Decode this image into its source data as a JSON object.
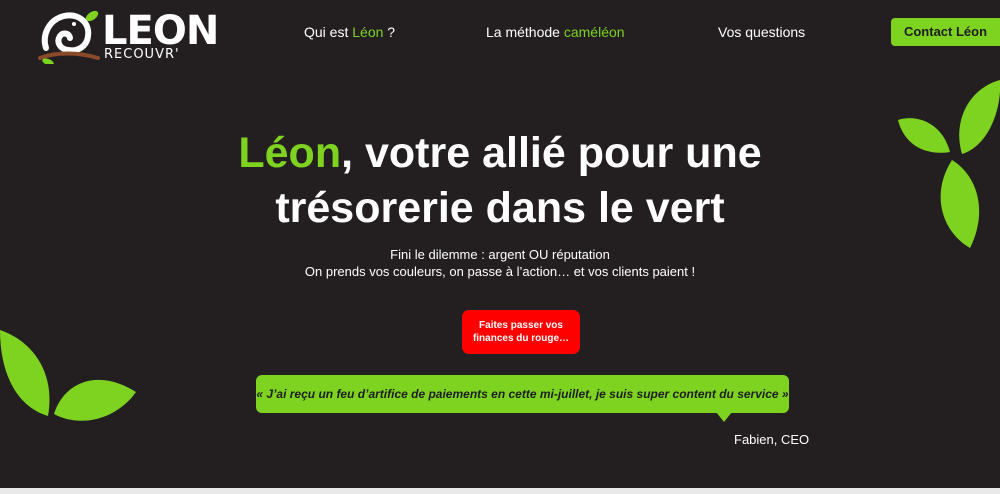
{
  "colors": {
    "background": "#231f20",
    "accent_green": "#7ed321",
    "cta_red": "#ff0000",
    "text_white": "#ffffff"
  },
  "logo": {
    "main": "LEON",
    "sub": "RECOUVR'",
    "icon": "chameleon-icon"
  },
  "nav": {
    "items": [
      {
        "prefix": "Qui est ",
        "highlight": "Léon",
        "suffix": " ?"
      },
      {
        "prefix": "La méthode ",
        "highlight": "caméléon",
        "suffix": ""
      },
      {
        "prefix": "Vos questions",
        "highlight": "",
        "suffix": ""
      }
    ],
    "contact_label": "Contact Léon"
  },
  "hero": {
    "title_highlight": "Léon",
    "title_line1_rest": ", votre allié pour une",
    "title_line2": "trésorerie dans le vert",
    "subtitle_line1": "Fini le dilemme : argent OU réputation",
    "subtitle_line2": "On prends vos couleurs, on passe à l’action… et vos clients paient !",
    "cta_label": "Faites passer vos finances du rouge…"
  },
  "testimonial": {
    "quote": "« J’ai reçu un feu d’artifice de paiements en cette mi-juillet, je suis super content du service »",
    "author": "Fabien, CEO"
  },
  "decorations": {
    "leaf_icon": "leaf-icon"
  }
}
